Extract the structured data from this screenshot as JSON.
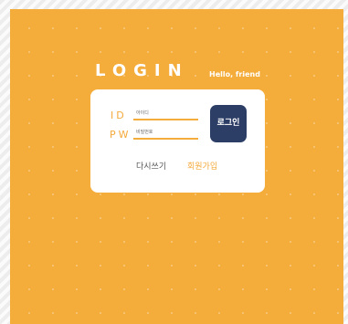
{
  "header": {
    "title": "LOGIN",
    "greeting": "Hello, friend"
  },
  "form": {
    "id_label": "ID",
    "pw_label": "PW",
    "id_placeholder": "아이디",
    "pw_placeholder": "비밀번호",
    "id_value": "",
    "pw_value": "",
    "login_label": "로그인"
  },
  "links": {
    "rewrite_label": "다시쓰기",
    "join_label": "회원가입"
  },
  "colors": {
    "background_orange": "#f4ac3b",
    "card": "#ffffff",
    "login_button": "#2c3e66",
    "accent_text": "#f4a93a"
  }
}
